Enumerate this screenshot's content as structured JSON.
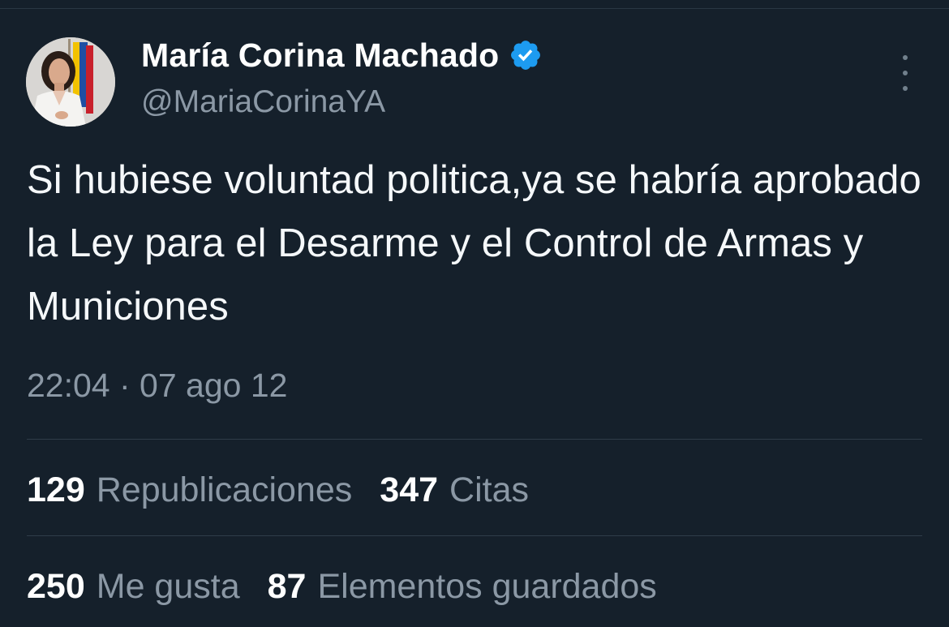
{
  "tweet": {
    "author": {
      "display_name": "María Corina Machado",
      "handle": "@MariaCorinaYA",
      "verified_icon": "verified-badge-icon",
      "avatar": "profile-photo"
    },
    "text": "Si hubiese voluntad politica,ya se habría aprobado la Ley para el Desarme y el Control de Armas y Municiones",
    "timestamp": "22:04 · 07 ago 12"
  },
  "stats": {
    "row1": [
      {
        "count": "129",
        "label": "Republicaciones"
      },
      {
        "count": "347",
        "label": "Citas"
      }
    ],
    "row2": [
      {
        "count": "250",
        "label": "Me gusta"
      },
      {
        "count": "87",
        "label": "Elementos guardados"
      }
    ]
  },
  "colors": {
    "background": "#15202b",
    "primary_text": "#e7e9ea",
    "secondary_text": "#8b98a5",
    "verified_blue": "#1d9bf0",
    "divider": "#2f3c49"
  }
}
